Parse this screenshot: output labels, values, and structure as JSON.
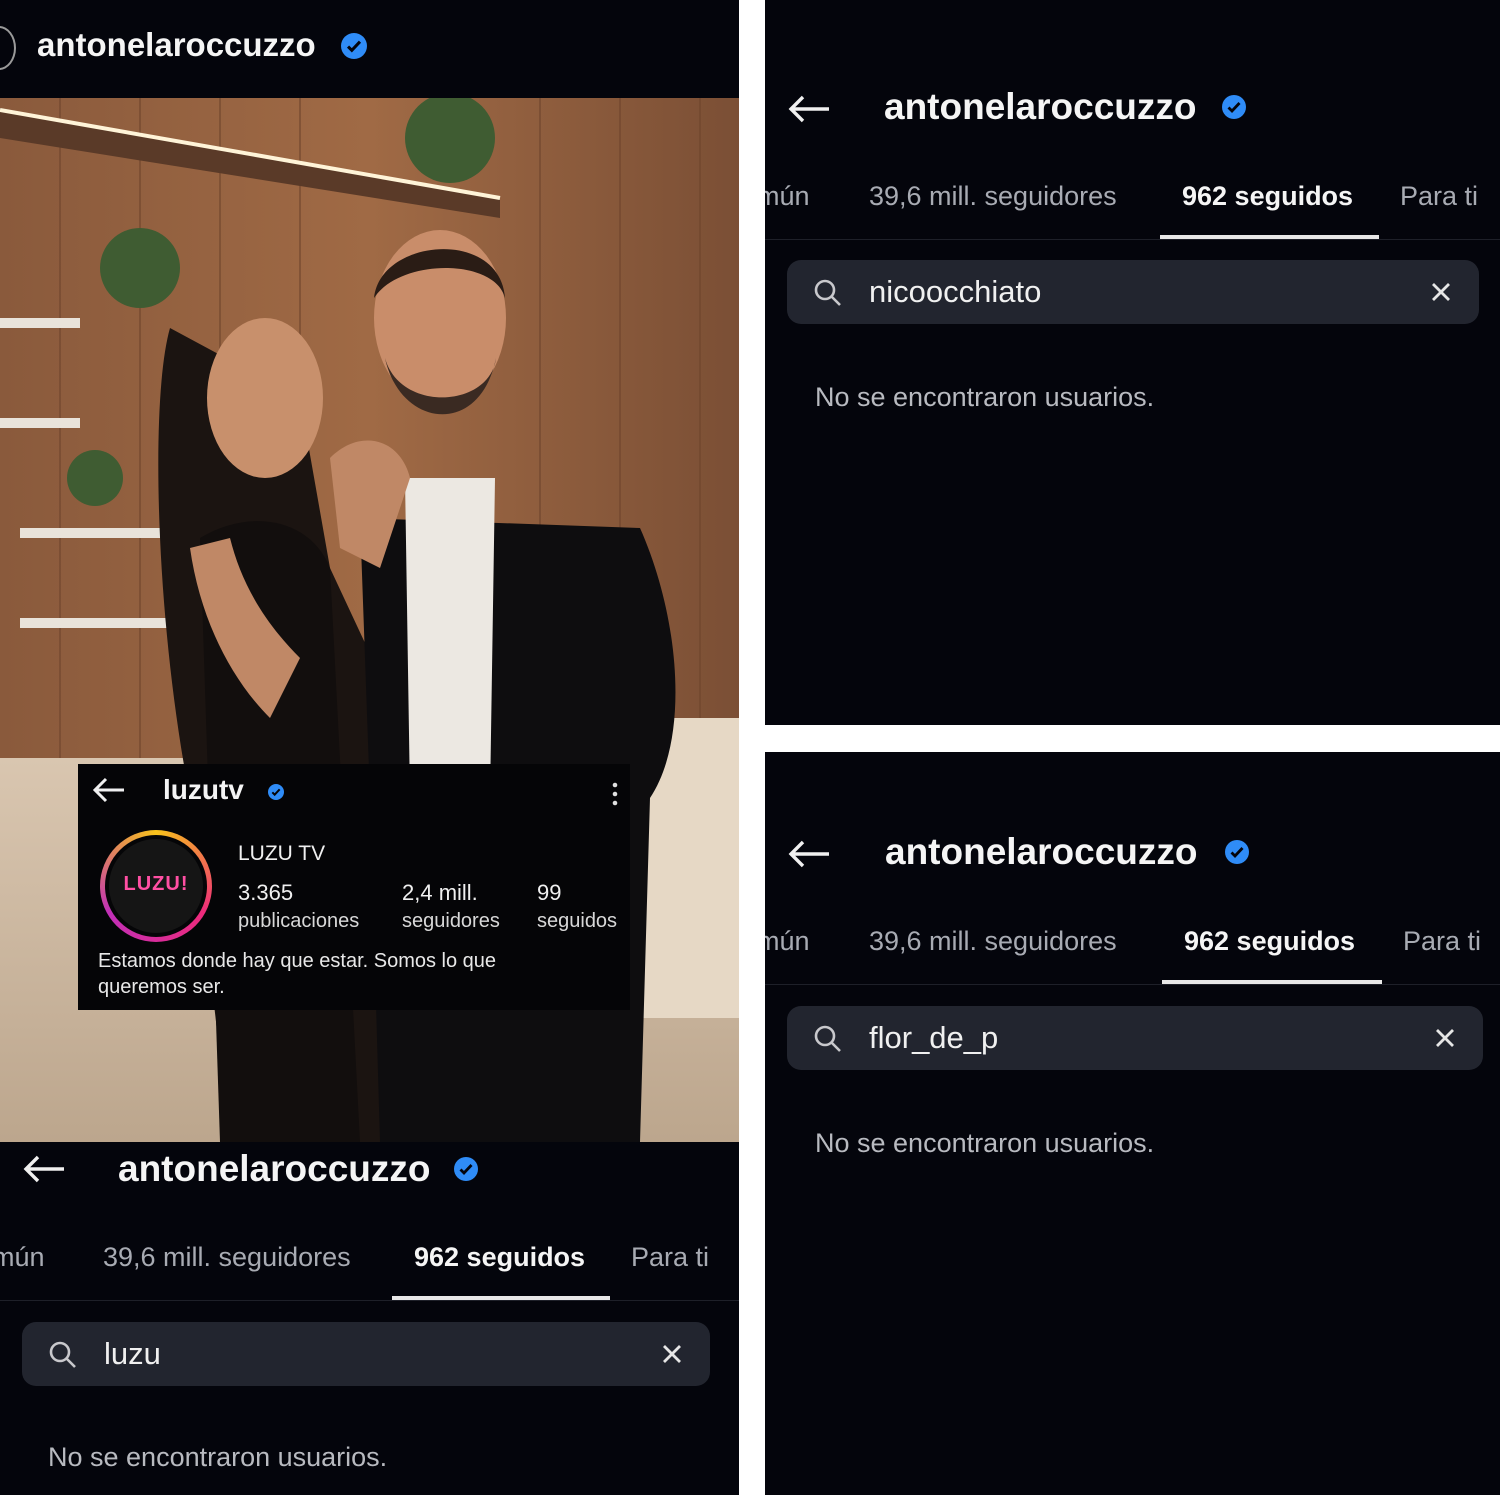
{
  "photo_post": {
    "username": "antonelaroccuzzo",
    "verified": true,
    "photo_description_icon": "couple-photo",
    "overlay": {
      "username": "luzutv",
      "verified": true,
      "avatar_text": "LUZU!",
      "display_name": "LUZU TV",
      "stats": [
        {
          "value": "3.365",
          "label": "publicaciones"
        },
        {
          "value": "2,4 mill.",
          "label": "seguidores"
        },
        {
          "value": "99",
          "label": "seguidos"
        }
      ],
      "bio": "Estamos donde hay que estar. Somos lo que queremos ser."
    }
  },
  "screens": [
    {
      "username": "antonelaroccuzzo",
      "tabs": [
        "mún",
        "39,6 mill. seguidores",
        "962 seguidos",
        "Para ti"
      ],
      "active_tab": 2,
      "search_value": "luzu",
      "empty_message": "No se encontraron usuarios."
    },
    {
      "username": "antonelaroccuzzo",
      "tabs": [
        "mún",
        "39,6 mill. seguidores",
        "962 seguidos",
        "Para ti"
      ],
      "active_tab": 2,
      "search_value": "nicoocchiato",
      "empty_message": "No se encontraron usuarios."
    },
    {
      "username": "antonelaroccuzzo",
      "tabs": [
        "mún",
        "39,6 mill. seguidores",
        "962 seguidos",
        "Para ti"
      ],
      "active_tab": 2,
      "search_value": "flor_de_p",
      "empty_message": "No se encontraron usuarios."
    }
  ],
  "colors": {
    "background": "#04050c",
    "verified": "#2f8cf7",
    "search_bg": "#22252f",
    "muted_text": "#a8abb3"
  }
}
